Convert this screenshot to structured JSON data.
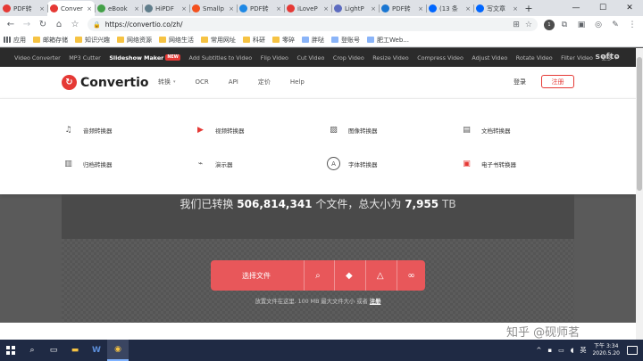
{
  "browser": {
    "tabs": [
      {
        "label": "PDF转",
        "favicon": "pdf-favicon",
        "color": "#e53935",
        "active": false
      },
      {
        "label": "Conver",
        "favicon": "convertio-favicon",
        "color": "#e53935",
        "active": true
      },
      {
        "label": "eBook",
        "favicon": "ebook-favicon",
        "color": "#43a047",
        "active": false
      },
      {
        "label": "HiPDF",
        "favicon": "hipdf-favicon",
        "color": "#607d8b",
        "active": false
      },
      {
        "label": "Smallp",
        "favicon": "smallpdf-favicon",
        "color": "#f4511e",
        "active": false
      },
      {
        "label": "PDF转",
        "favicon": "pdf-favicon",
        "color": "#1e88e5",
        "active": false
      },
      {
        "label": "iLoveP",
        "favicon": "ilovepdf-favicon",
        "color": "#e53935",
        "active": false
      },
      {
        "label": "LightP",
        "favicon": "lightpdf-favicon",
        "color": "#5c6bc0",
        "active": false
      },
      {
        "label": "PDF转",
        "favicon": "pdf-favicon",
        "color": "#1976d2",
        "active": false
      },
      {
        "label": "(13 条",
        "favicon": "zhihu-favicon",
        "color": "#0066ff",
        "active": false
      },
      {
        "label": "写文章",
        "favicon": "zhihu-favicon",
        "color": "#0066ff",
        "active": false
      }
    ],
    "tab_close_glyph": "×",
    "new_tab_glyph": "+",
    "window_controls": {
      "minimize": "—",
      "maximize": "☐",
      "close": "✕"
    },
    "url": "https://convertio.co/zh/",
    "profile_badge": "1",
    "bookmarks": [
      {
        "label": "应用",
        "icon": "apps-icon"
      },
      {
        "label": "邮箱存储",
        "icon": "folder-icon"
      },
      {
        "label": "知识兴趣",
        "icon": "folder-icon"
      },
      {
        "label": "网络资源",
        "icon": "folder-icon"
      },
      {
        "label": "网络生活",
        "icon": "folder-icon"
      },
      {
        "label": "常用网址",
        "icon": "folder-icon"
      },
      {
        "label": "科研",
        "icon": "folder-icon"
      },
      {
        "label": "零碎",
        "icon": "folder-icon"
      },
      {
        "label": "胖哒",
        "icon": "page-icon"
      },
      {
        "label": "登账号",
        "icon": "page-icon"
      },
      {
        "label": "肥工Web...",
        "icon": "page-icon"
      }
    ]
  },
  "tools_bar": {
    "items": [
      "Video Converter",
      "MP3 Cutter",
      "Slideshow Maker",
      "Add Subtitles to Video",
      "Flip Video",
      "Cut Video",
      "Crop Video",
      "Resize Video",
      "Compress Video",
      "Adjust Video",
      "Rotate Video",
      "Filter Video",
      "更多 ▾"
    ],
    "bold_item": "Slideshow Maker",
    "new_badge": "NEW",
    "brand": "softo"
  },
  "header": {
    "logo_text": "Convertio",
    "nav": [
      {
        "label": "转换",
        "has_caret": true
      },
      {
        "label": "OCR",
        "has_caret": false
      },
      {
        "label": "API",
        "has_caret": false
      },
      {
        "label": "定价",
        "has_caret": false
      },
      {
        "label": "Help",
        "has_caret": false
      }
    ],
    "login": "登录",
    "register": "注册",
    "accent": "#e53935"
  },
  "converters": [
    {
      "label": "音频转换器",
      "icon": "music-note-icon"
    },
    {
      "label": "视频转换器",
      "icon": "video-play-icon"
    },
    {
      "label": "图像转换器",
      "icon": "image-icon"
    },
    {
      "label": "文档转换器",
      "icon": "document-icon"
    },
    {
      "label": "归档转换器",
      "icon": "archive-icon"
    },
    {
      "label": "演示器",
      "icon": "presentation-icon"
    },
    {
      "label": "字体转换器",
      "icon": "font-icon"
    },
    {
      "label": "电子书转换器",
      "icon": "ebook-icon"
    }
  ],
  "hero": {
    "stats_prefix": "我们已转换",
    "files_count": "506,814,341",
    "stats_mid": "个文件，总大小为",
    "total_size": "7,955",
    "size_unit": "TB",
    "upload_label": "选择文件",
    "upload_sources": [
      "folder-search-icon",
      "dropbox-icon",
      "google-drive-icon",
      "link-icon"
    ],
    "drop_text": "放置文件在这里. 100 MB 最大文件大小 或者",
    "drop_register": "注册"
  },
  "watermark": "知乎 @砚师茗",
  "taskbar": {
    "clock_time": "下午 3:34",
    "clock_date": "2020.5.20",
    "ime": "英"
  }
}
